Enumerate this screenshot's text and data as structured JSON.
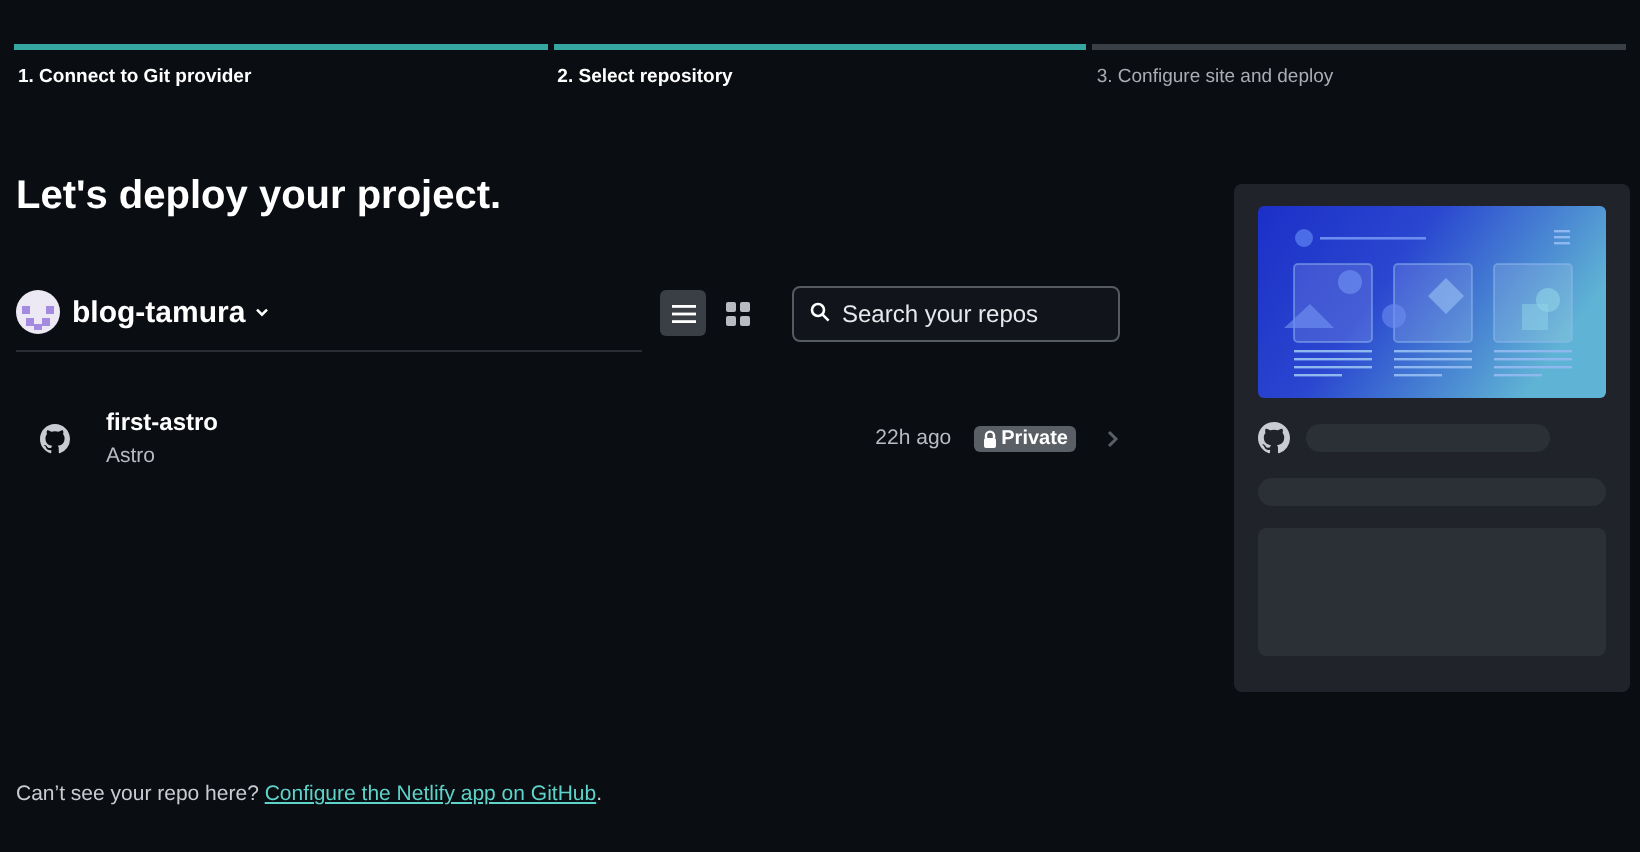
{
  "steps": [
    {
      "label": "1. Connect to Git provider",
      "completed": true
    },
    {
      "label": "2. Select repository",
      "completed": true
    },
    {
      "label": "3. Configure site and deploy",
      "completed": false
    }
  ],
  "heading": "Let's deploy your project.",
  "account": {
    "name": "blog-tamura"
  },
  "view_toggle": [
    {
      "kind": "list",
      "selected": true
    },
    {
      "kind": "grid",
      "selected": false
    }
  ],
  "search": {
    "placeholder": "Search your repos"
  },
  "repos": [
    {
      "name": "first-astro",
      "framework": "Astro",
      "updated": "22h ago",
      "visibility": "Private"
    }
  ],
  "footer": {
    "text": "Can’t see your repo here?",
    "link": "Configure the Netlify app on GitHub",
    "suffix": "."
  }
}
